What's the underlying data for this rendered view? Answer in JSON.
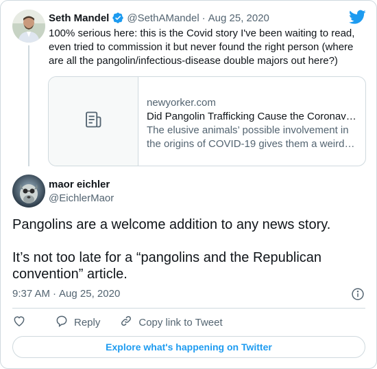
{
  "parent_tweet": {
    "author_name": "Seth Mandel",
    "verified": true,
    "handle": "@SethAMandel",
    "separator": "·",
    "date": "Aug 25, 2020",
    "text": "100% serious here: this is the Covid story I've been waiting to read, even tried to commission it but never found the right person (where are all the pangolin/infectious-disease double majors out here?)",
    "link_card": {
      "domain": "newyorker.com",
      "title": "Did Pangolin Trafficking Cause the Coronavirus Pandemic?",
      "description": "The elusive animals’ possible involvement in the origins of COVID-19 gives them a weird kind of celebrity.",
      "thumbnail_icon": "article-icon"
    }
  },
  "main_tweet": {
    "author_name": "maor eichler",
    "handle": "@EichlerMaor",
    "text_lines": [
      "Pangolins are a welcome addition to any news story.",
      "It’s not too late for a “pangolins and the Republican convention” article."
    ],
    "time": "9:37 AM",
    "separator": "·",
    "date": "Aug 25, 2020"
  },
  "actions": {
    "like_icon": "heart-icon",
    "reply_label": "Reply",
    "copy_link_label": "Copy link to Tweet"
  },
  "explore_button_label": "Explore what's happening on Twitter",
  "colors": {
    "accent": "#1d9bf0",
    "text": "#0f1419",
    "secondary_text": "#536471",
    "border": "#cfd9de"
  }
}
